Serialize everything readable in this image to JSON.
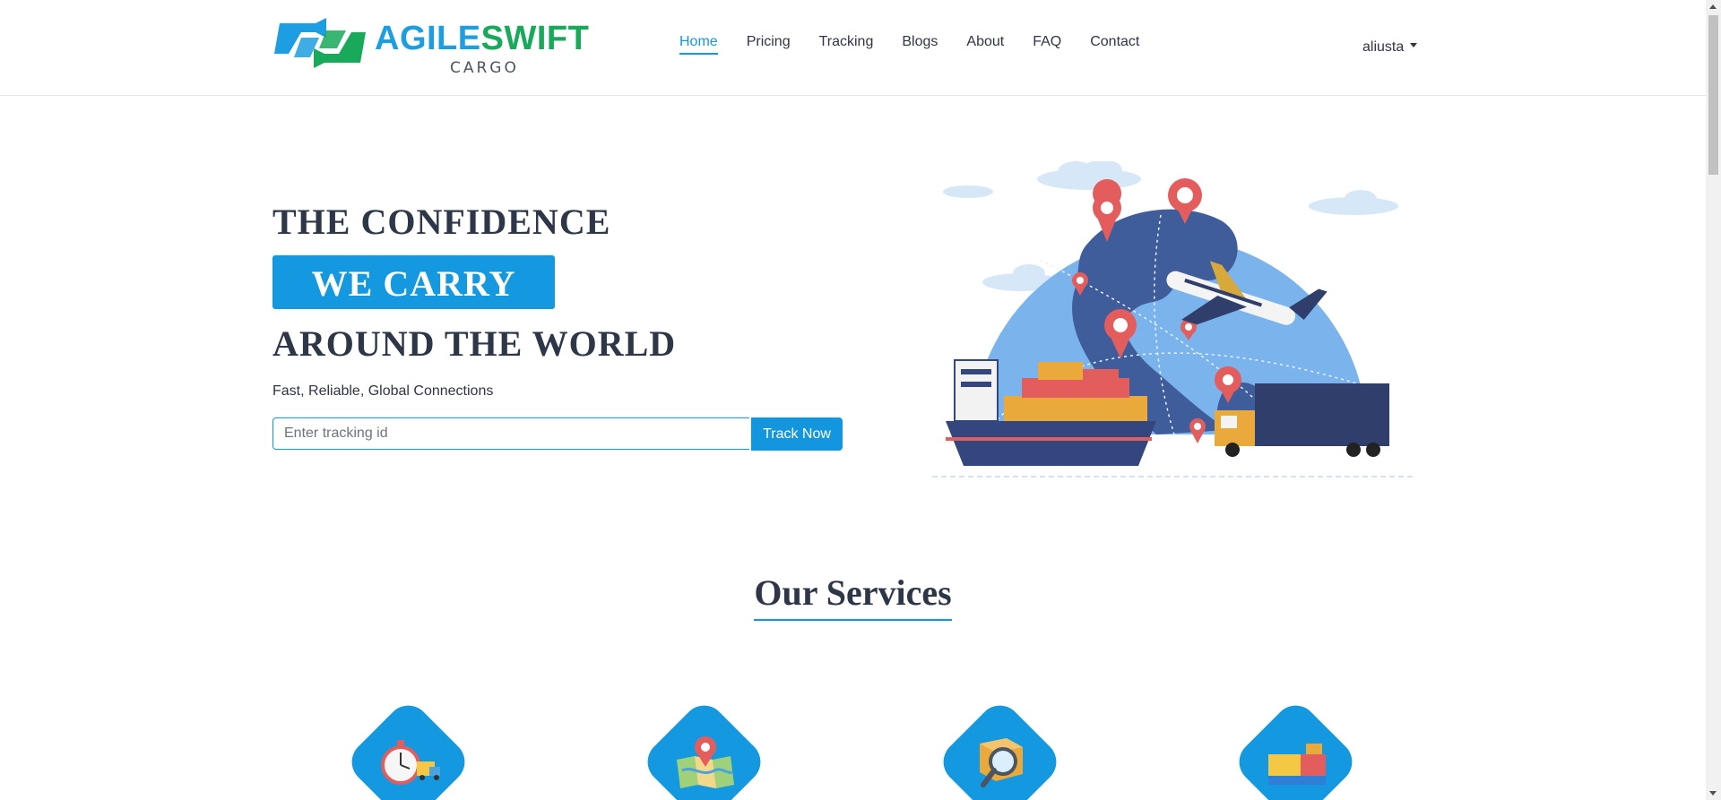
{
  "brand": {
    "name_part1": "AGILE",
    "name_part2": "SWIFT",
    "sub": "CARGO",
    "colors": {
      "blue": "#1e9ee2",
      "green": "#18a95a"
    }
  },
  "nav": {
    "items": [
      {
        "label": "Home",
        "active": true
      },
      {
        "label": "Pricing",
        "active": false
      },
      {
        "label": "Tracking",
        "active": false
      },
      {
        "label": "Blogs",
        "active": false
      },
      {
        "label": "About",
        "active": false
      },
      {
        "label": "FAQ",
        "active": false
      },
      {
        "label": "Contact",
        "active": false
      }
    ],
    "user": "aliusta"
  },
  "hero": {
    "line1": "THE CONFIDENCE",
    "line2": "WE CARRY",
    "line3": "AROUND THE WORLD",
    "tagline": "Fast, Reliable, Global Connections",
    "tracking_placeholder": "Enter tracking id",
    "tracking_value": "",
    "track_button": "Track Now",
    "illustration": "globe-with-map-pins-airplane-cargo-ship-truck"
  },
  "services": {
    "title": "Our Services",
    "icons": [
      "stopwatch-truck-icon",
      "map-pin-icon",
      "package-search-icon",
      "cargo-containers-icon"
    ]
  },
  "colors": {
    "accent": "#1496df",
    "heading": "#2d3748",
    "text": "#2f3542"
  }
}
